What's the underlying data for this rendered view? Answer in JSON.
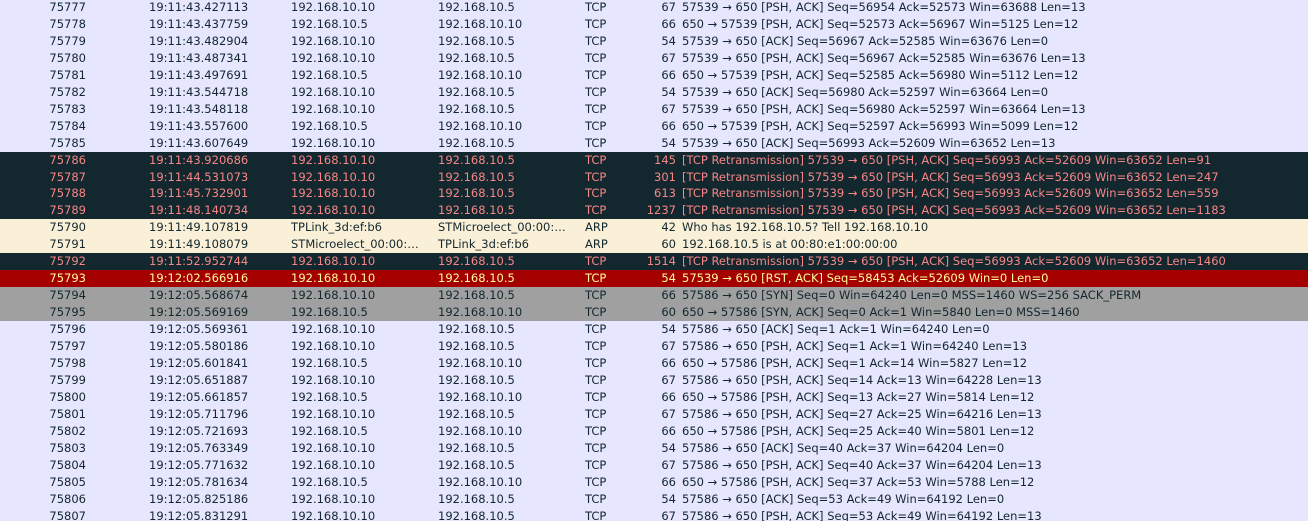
{
  "packets": [
    {
      "no": "75777",
      "time": "19:11:43.427113",
      "src": "192.168.10.10",
      "dst": "192.168.10.5",
      "proto": "TCP",
      "len": "67",
      "info": "57539 → 650 [PSH, ACK] Seq=56954 Ack=52573 Win=63688 Len=13",
      "style": "normal"
    },
    {
      "no": "75778",
      "time": "19:11:43.437759",
      "src": "192.168.10.5",
      "dst": "192.168.10.10",
      "proto": "TCP",
      "len": "66",
      "info": "650 → 57539 [PSH, ACK] Seq=52573 Ack=56967 Win=5125 Len=12",
      "style": "normal"
    },
    {
      "no": "75779",
      "time": "19:11:43.482904",
      "src": "192.168.10.10",
      "dst": "192.168.10.5",
      "proto": "TCP",
      "len": "54",
      "info": "57539 → 650 [ACK] Seq=56967 Ack=52585 Win=63676 Len=0",
      "style": "normal"
    },
    {
      "no": "75780",
      "time": "19:11:43.487341",
      "src": "192.168.10.10",
      "dst": "192.168.10.5",
      "proto": "TCP",
      "len": "67",
      "info": "57539 → 650 [PSH, ACK] Seq=56967 Ack=52585 Win=63676 Len=13",
      "style": "normal"
    },
    {
      "no": "75781",
      "time": "19:11:43.497691",
      "src": "192.168.10.5",
      "dst": "192.168.10.10",
      "proto": "TCP",
      "len": "66",
      "info": "650 → 57539 [PSH, ACK] Seq=52585 Ack=56980 Win=5112 Len=12",
      "style": "normal"
    },
    {
      "no": "75782",
      "time": "19:11:43.544718",
      "src": "192.168.10.10",
      "dst": "192.168.10.5",
      "proto": "TCP",
      "len": "54",
      "info": "57539 → 650 [ACK] Seq=56980 Ack=52597 Win=63664 Len=0",
      "style": "normal"
    },
    {
      "no": "75783",
      "time": "19:11:43.548118",
      "src": "192.168.10.10",
      "dst": "192.168.10.5",
      "proto": "TCP",
      "len": "67",
      "info": "57539 → 650 [PSH, ACK] Seq=56980 Ack=52597 Win=63664 Len=13",
      "style": "normal"
    },
    {
      "no": "75784",
      "time": "19:11:43.557600",
      "src": "192.168.10.5",
      "dst": "192.168.10.10",
      "proto": "TCP",
      "len": "66",
      "info": "650 → 57539 [PSH, ACK] Seq=52597 Ack=56993 Win=5099 Len=12",
      "style": "normal"
    },
    {
      "no": "75785",
      "time": "19:11:43.607649",
      "src": "192.168.10.10",
      "dst": "192.168.10.5",
      "proto": "TCP",
      "len": "54",
      "info": "57539 → 650 [ACK] Seq=56993 Ack=52609 Win=63652 Len=13",
      "style": "normal"
    },
    {
      "no": "75786",
      "time": "19:11:43.920686",
      "src": "192.168.10.10",
      "dst": "192.168.10.5",
      "proto": "TCP",
      "len": "145",
      "info": "[TCP Retransmission] 57539 → 650 [PSH, ACK] Seq=56993 Ack=52609 Win=63652 Len=91",
      "style": "err"
    },
    {
      "no": "75787",
      "time": "19:11:44.531073",
      "src": "192.168.10.10",
      "dst": "192.168.10.5",
      "proto": "TCP",
      "len": "301",
      "info": "[TCP Retransmission] 57539 → 650 [PSH, ACK] Seq=56993 Ack=52609 Win=63652 Len=247",
      "style": "err"
    },
    {
      "no": "75788",
      "time": "19:11:45.732901",
      "src": "192.168.10.10",
      "dst": "192.168.10.5",
      "proto": "TCP",
      "len": "613",
      "info": "[TCP Retransmission] 57539 → 650 [PSH, ACK] Seq=56993 Ack=52609 Win=63652 Len=559",
      "style": "err"
    },
    {
      "no": "75789",
      "time": "19:11:48.140734",
      "src": "192.168.10.10",
      "dst": "192.168.10.5",
      "proto": "TCP",
      "len": "1237",
      "info": "[TCP Retransmission] 57539 → 650 [PSH, ACK] Seq=56993 Ack=52609 Win=63652 Len=1183",
      "style": "err"
    },
    {
      "no": "75790",
      "time": "19:11:49.107819",
      "src": "TPLink_3d:ef:b6",
      "dst": "STMicroelect_00:00:…",
      "proto": "ARP",
      "len": "42",
      "info": "Who has 192.168.10.5? Tell 192.168.10.10",
      "style": "arp"
    },
    {
      "no": "75791",
      "time": "19:11:49.108079",
      "src": "STMicroelect_00:00:…",
      "dst": "TPLink_3d:ef:b6",
      "proto": "ARP",
      "len": "60",
      "info": "192.168.10.5 is at 00:80:e1:00:00:00",
      "style": "arp"
    },
    {
      "no": "75792",
      "time": "19:11:52.952744",
      "src": "192.168.10.10",
      "dst": "192.168.10.5",
      "proto": "TCP",
      "len": "1514",
      "info": "[TCP Retransmission] 57539 → 650 [PSH, ACK] Seq=56993 Ack=52609 Win=63652 Len=1460",
      "style": "err"
    },
    {
      "no": "75793",
      "time": "19:12:02.566916",
      "src": "192.168.10.10",
      "dst": "192.168.10.5",
      "proto": "TCP",
      "len": "54",
      "info": "57539 → 650 [RST, ACK] Seq=58453 Ack=52609 Win=0 Len=0",
      "style": "rst"
    },
    {
      "no": "75794",
      "time": "19:12:05.568674",
      "src": "192.168.10.10",
      "dst": "192.168.10.5",
      "proto": "TCP",
      "len": "66",
      "info": "57586 → 650 [SYN] Seq=0 Win=64240 Len=0 MSS=1460 WS=256 SACK_PERM",
      "style": "syn"
    },
    {
      "no": "75795",
      "time": "19:12:05.569169",
      "src": "192.168.10.5",
      "dst": "192.168.10.10",
      "proto": "TCP",
      "len": "60",
      "info": "650 → 57586 [SYN, ACK] Seq=0 Ack=1 Win=5840 Len=0 MSS=1460",
      "style": "syn"
    },
    {
      "no": "75796",
      "time": "19:12:05.569361",
      "src": "192.168.10.10",
      "dst": "192.168.10.5",
      "proto": "TCP",
      "len": "54",
      "info": "57586 → 650 [ACK] Seq=1 Ack=1 Win=64240 Len=0",
      "style": "normal"
    },
    {
      "no": "75797",
      "time": "19:12:05.580186",
      "src": "192.168.10.10",
      "dst": "192.168.10.5",
      "proto": "TCP",
      "len": "67",
      "info": "57586 → 650 [PSH, ACK] Seq=1 Ack=1 Win=64240 Len=13",
      "style": "normal"
    },
    {
      "no": "75798",
      "time": "19:12:05.601841",
      "src": "192.168.10.5",
      "dst": "192.168.10.10",
      "proto": "TCP",
      "len": "66",
      "info": "650 → 57586 [PSH, ACK] Seq=1 Ack=14 Win=5827 Len=12",
      "style": "normal"
    },
    {
      "no": "75799",
      "time": "19:12:05.651887",
      "src": "192.168.10.10",
      "dst": "192.168.10.5",
      "proto": "TCP",
      "len": "67",
      "info": "57586 → 650 [PSH, ACK] Seq=14 Ack=13 Win=64228 Len=13",
      "style": "normal"
    },
    {
      "no": "75800",
      "time": "19:12:05.661857",
      "src": "192.168.10.5",
      "dst": "192.168.10.10",
      "proto": "TCP",
      "len": "66",
      "info": "650 → 57586 [PSH, ACK] Seq=13 Ack=27 Win=5814 Len=12",
      "style": "normal"
    },
    {
      "no": "75801",
      "time": "19:12:05.711796",
      "src": "192.168.10.10",
      "dst": "192.168.10.5",
      "proto": "TCP",
      "len": "67",
      "info": "57586 → 650 [PSH, ACK] Seq=27 Ack=25 Win=64216 Len=13",
      "style": "normal"
    },
    {
      "no": "75802",
      "time": "19:12:05.721693",
      "src": "192.168.10.5",
      "dst": "192.168.10.10",
      "proto": "TCP",
      "len": "66",
      "info": "650 → 57586 [PSH, ACK] Seq=25 Ack=40 Win=5801 Len=12",
      "style": "normal"
    },
    {
      "no": "75803",
      "time": "19:12:05.763349",
      "src": "192.168.10.10",
      "dst": "192.168.10.5",
      "proto": "TCP",
      "len": "54",
      "info": "57586 → 650 [ACK] Seq=40 Ack=37 Win=64204 Len=0",
      "style": "normal"
    },
    {
      "no": "75804",
      "time": "19:12:05.771632",
      "src": "192.168.10.10",
      "dst": "192.168.10.5",
      "proto": "TCP",
      "len": "67",
      "info": "57586 → 650 [PSH, ACK] Seq=40 Ack=37 Win=64204 Len=13",
      "style": "normal"
    },
    {
      "no": "75805",
      "time": "19:12:05.781634",
      "src": "192.168.10.5",
      "dst": "192.168.10.10",
      "proto": "TCP",
      "len": "66",
      "info": "650 → 57586 [PSH, ACK] Seq=37 Ack=53 Win=5788 Len=12",
      "style": "normal"
    },
    {
      "no": "75806",
      "time": "19:12:05.825186",
      "src": "192.168.10.10",
      "dst": "192.168.10.5",
      "proto": "TCP",
      "len": "54",
      "info": "57586 → 650 [ACK] Seq=53 Ack=49 Win=64192 Len=0",
      "style": "normal"
    },
    {
      "no": "75807",
      "time": "19:12:05.831291",
      "src": "192.168.10.10",
      "dst": "192.168.10.5",
      "proto": "TCP",
      "len": "67",
      "info": "57586 → 650 [PSH, ACK] Seq=53 Ack=49 Win=64192 Len=13",
      "style": "normal"
    }
  ],
  "colors": {
    "normal_bg": "#e7e6ff",
    "normal_fg": "#12272e",
    "err_bg": "#12272e",
    "err_fg": "#f78787",
    "arp_bg": "#faf0d7",
    "rst_bg": "#a40000",
    "rst_fg": "#fffc9c",
    "syn_bg": "#a0a0a0"
  }
}
